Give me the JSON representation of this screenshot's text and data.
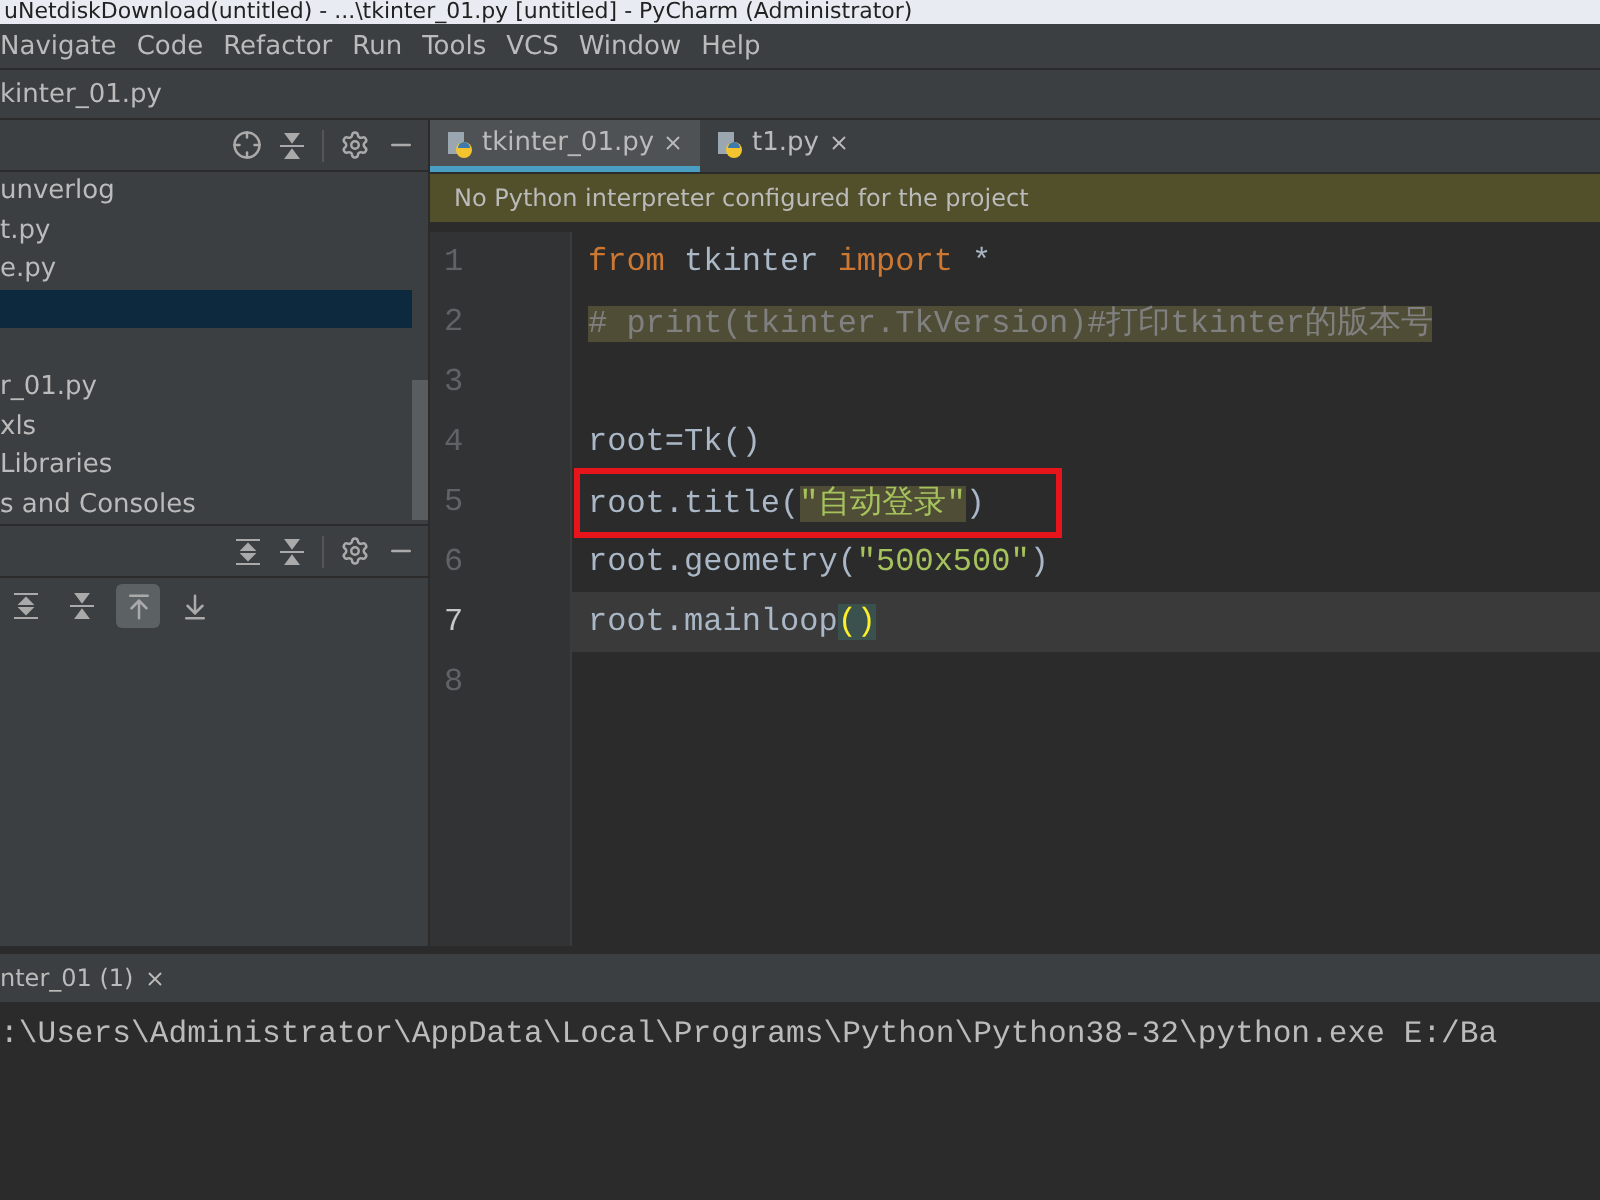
{
  "window": {
    "title": "uNetdiskDownload(untitled) - ...\\tkinter_01.py [untitled] - PyCharm (Administrator)"
  },
  "menu": [
    "Navigate",
    "Code",
    "Refactor",
    "Run",
    "Tools",
    "VCS",
    "Window",
    "Help"
  ],
  "breadcrumb": "kinter_01.py",
  "project_tree": [
    {
      "label": "unverlog",
      "selected": false
    },
    {
      "label": "t.py",
      "selected": false
    },
    {
      "label": "e.py",
      "selected": false
    },
    {
      "selected": true
    },
    {
      "selected": false
    },
    {
      "label": "r_01.py",
      "selected": false
    },
    {
      "label": "xls",
      "selected": false
    },
    {
      "label": "Libraries",
      "selected": false
    },
    {
      "label": "s and Consoles",
      "selected": false
    }
  ],
  "structure_toolbar": [
    {
      "kind": "expand",
      "selected": false
    },
    {
      "kind": "collapse",
      "selected": false
    },
    {
      "kind": "scroll-from",
      "selected": true
    },
    {
      "kind": "scroll-to",
      "selected": false
    }
  ],
  "editor_tabs": [
    {
      "label": "tkinter_01.py",
      "selected": true
    },
    {
      "label": "t1.py",
      "selected": false
    }
  ],
  "banner": "No Python interpreter configured for the project",
  "code_lines": [
    {
      "number": "1",
      "current": false,
      "boxed": false,
      "tokens": [
        {
          "kind": "keyword",
          "text": "from"
        },
        {
          "kind": "plain",
          "text": " tkinter "
        },
        {
          "kind": "keyword",
          "text": "import"
        },
        {
          "kind": "plain",
          "text": " *"
        }
      ]
    },
    {
      "number": "2",
      "current": false,
      "boxed": false,
      "tokens": [
        {
          "kind": "comment-hl",
          "text": "# print(tkinter.TkVersion)#打印tkinter的版本号"
        }
      ]
    },
    {
      "number": "3",
      "current": false,
      "boxed": false
    },
    {
      "number": "4",
      "current": false,
      "boxed": false,
      "tokens": [
        {
          "kind": "plain",
          "text": "root=Tk()"
        }
      ]
    },
    {
      "number": "5",
      "current": false,
      "boxed": true,
      "tokens": [
        {
          "kind": "plain",
          "text": "root.title("
        },
        {
          "kind": "string-hl",
          "text": "\"自动登录\""
        },
        {
          "kind": "plain",
          "text": ")"
        }
      ]
    },
    {
      "number": "6",
      "current": false,
      "boxed": false,
      "tokens": [
        {
          "kind": "plain",
          "text": "root.geometry("
        },
        {
          "kind": "string",
          "text": "\"500x500\""
        },
        {
          "kind": "plain",
          "text": ")"
        }
      ]
    },
    {
      "number": "7",
      "current": true,
      "boxed": false,
      "tokens": [
        {
          "kind": "plain",
          "text": "root.mainloop"
        },
        {
          "kind": "brace-hl",
          "text": "()"
        }
      ]
    },
    {
      "number": "8",
      "current": false,
      "boxed": false
    }
  ],
  "run_tab": "nter_01 (1)",
  "console_output": ":\\Users\\Administrator\\AppData\\Local\\Programs\\Python\\Python38-32\\python.exe E:/Ba"
}
